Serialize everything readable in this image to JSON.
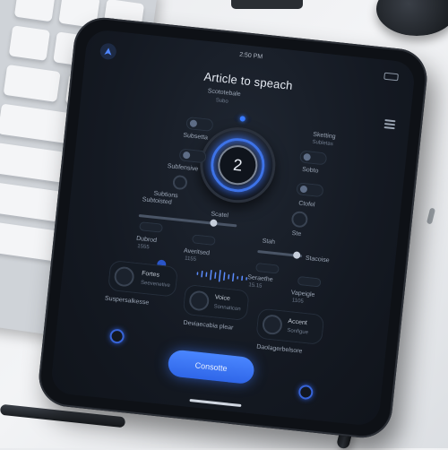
{
  "status": {
    "time": "2:50 PM"
  },
  "app": {
    "title": "Article to speach"
  },
  "header": {
    "left_label": "Scototebale",
    "left_value": "Subo",
    "right_label": "Sketting",
    "right_value": "Subletas"
  },
  "dial": {
    "value": "2"
  },
  "left_panel": {
    "item1": "Subsetta",
    "item2": "Subfensive",
    "item3": "Subtions"
  },
  "right_panel": {
    "item1": "Sobto",
    "item2": "Ctofel",
    "item3": "Ste"
  },
  "sliders": {
    "left_label": "Subtoisted",
    "left_right_label": "Scatel",
    "left_sub1": "Dubrod",
    "left_sub1_val": "1555",
    "left_sub2": "Averitsed",
    "left_sub2_val": "1155",
    "right_top": "Stah",
    "right_label": "Stacoise",
    "right_sub1": "Seraethe",
    "right_sub1_val": "15.15",
    "right_sub2": "Vapeigle",
    "right_sub2_val": "1105"
  },
  "cards": {
    "card1_title": "Fortes",
    "card1_sub": "Seevenetive",
    "card1_note": "Suspersalkesse",
    "card2_title": "Voice",
    "card2_sub": "Sonnaticon",
    "card2_note": "Deviaecabia plear",
    "card3_title": "Accent",
    "card3_sub": "Sonfigue",
    "card3_note": "Daolagerbelsore"
  },
  "primary_button": {
    "label": "Consotte"
  },
  "colors": {
    "accent": "#3a7bff",
    "screen_bg": "#141922",
    "button": "#2f66e8"
  },
  "icons": [
    "logo-icon",
    "battery-icon",
    "menu-icon",
    "voice-icon",
    "record-icon"
  ]
}
